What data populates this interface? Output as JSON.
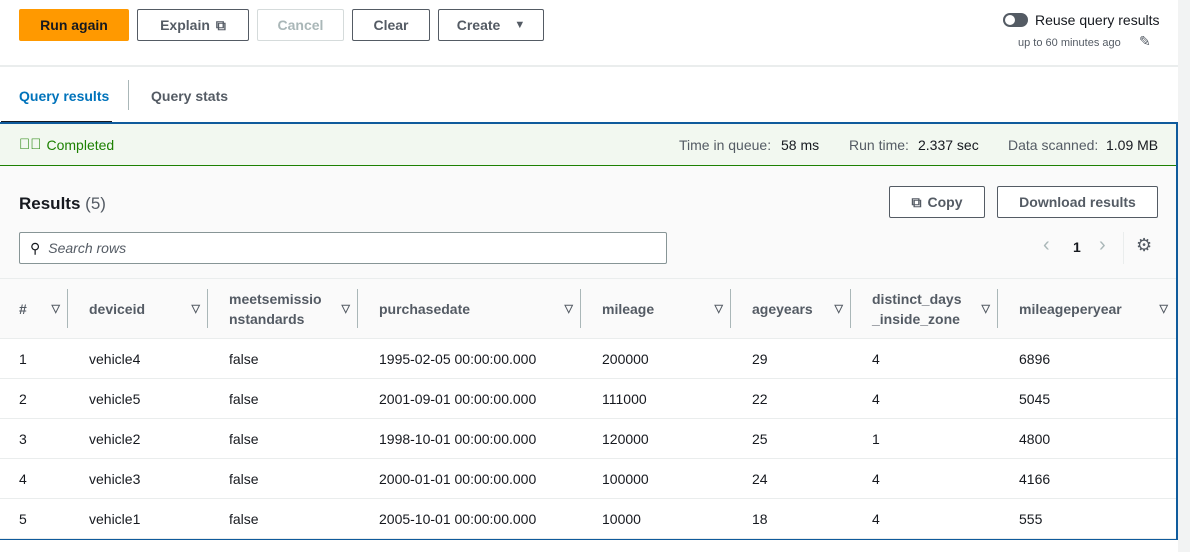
{
  "toolbar": {
    "run_again": "Run again",
    "explain": "Explain",
    "cancel": "Cancel",
    "clear": "Clear",
    "create": "Create"
  },
  "reuse": {
    "label": "Reuse query results",
    "sub": "up to 60 minutes ago"
  },
  "tabs": [
    "Query results",
    "Query stats"
  ],
  "status": {
    "state": "Completed",
    "queue_label": "Time in queue:",
    "queue": "58 ms",
    "run_label": "Run time:",
    "run": "2.337 sec",
    "scan_label": "Data scanned:",
    "scan": "1.09 MB"
  },
  "results": {
    "title": "Results",
    "count": "(5)",
    "copy": "Copy",
    "download": "Download results",
    "search_placeholder": "Search rows",
    "page": "1"
  },
  "columns": [
    "#",
    "deviceid",
    "meetsemissionstandards",
    "purchasedate",
    "mileage",
    "ageyears",
    "distinct_days_inside_zone",
    "mileageperyear"
  ],
  "rows": [
    [
      "1",
      "vehicle4",
      "false",
      "1995-02-05 00:00:00.000",
      "200000",
      "29",
      "4",
      "6896"
    ],
    [
      "2",
      "vehicle5",
      "false",
      "2001-09-01 00:00:00.000",
      "111000",
      "22",
      "4",
      "5045"
    ],
    [
      "3",
      "vehicle2",
      "false",
      "1998-10-01 00:00:00.000",
      "120000",
      "25",
      "1",
      "4800"
    ],
    [
      "4",
      "vehicle3",
      "false",
      "2000-01-01 00:00:00.000",
      "100000",
      "24",
      "4",
      "4166"
    ],
    [
      "5",
      "vehicle1",
      "false",
      "2005-10-01 00:00:00.000",
      "10000",
      "18",
      "4",
      "555"
    ]
  ]
}
